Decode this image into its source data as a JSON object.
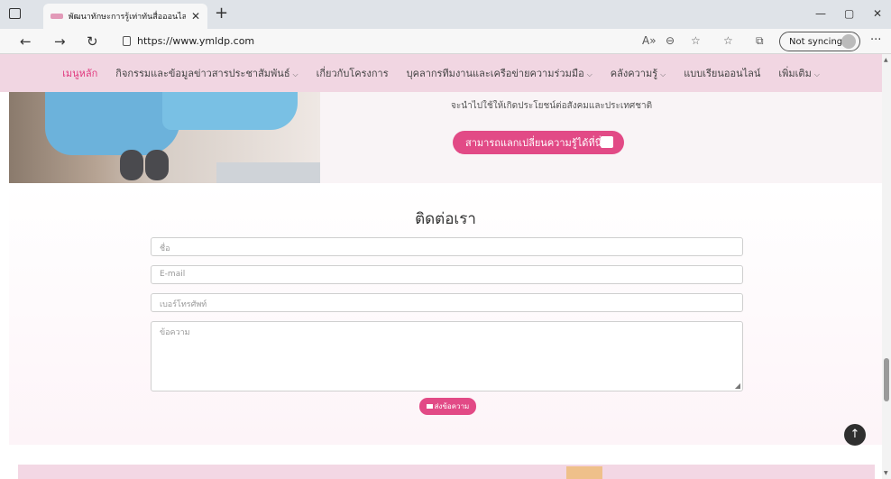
{
  "browser": {
    "tab_title": "พัฒนาทักษะการรู้เท่าทันสื่อออนไลน์ ไม่",
    "tab_close": "✕",
    "new_tab": "+",
    "url": "https://www.ymldp.com",
    "sync_label": "Not syncing",
    "window_controls": [
      "—",
      "▢",
      "✕"
    ],
    "icons": [
      "back-icon",
      "forward-icon",
      "refresh-icon",
      "lock-icon",
      "read-aloud-icon",
      "zoom-icon",
      "favorites-add-icon",
      "favorites-icon",
      "collections-icon",
      "profile-icon",
      "more-icon"
    ]
  },
  "nav": {
    "items": [
      {
        "label": "เมนูหลัก",
        "active": true,
        "dropdown": false
      },
      {
        "label": "กิจกรรมและข้อมูลข่าวสารประชาสัมพันธ์",
        "active": false,
        "dropdown": true
      },
      {
        "label": "เกี่ยวกับโครงการ",
        "active": false,
        "dropdown": false
      },
      {
        "label": "บุคลากรทีมงานและเครือข่ายความร่วมมือ",
        "active": false,
        "dropdown": true
      },
      {
        "label": "คลังความรู้",
        "active": false,
        "dropdown": true
      },
      {
        "label": "แบบเรียนออนไลน์",
        "active": false,
        "dropdown": false
      },
      {
        "label": "เพิ่มเติม",
        "active": false,
        "dropdown": true
      }
    ],
    "active_color": "#e0397e",
    "background": "#f1d6e2"
  },
  "hero": {
    "text": "จะนำไปใช้ให้เกิดประโยชน์ต่อสังคมและประเทศชาติ",
    "cta_label": "สามารถแลกเปลี่ยนความรู้ได้ที่นี่",
    "cta_color": "#e24a86"
  },
  "contact": {
    "title": "ติดต่อเรา",
    "name_placeholder": "ชื่อ",
    "email_placeholder": "E-mail",
    "phone_placeholder": "เบอร์โทรศัพท์",
    "message_placeholder": "ข้อความ",
    "send_label": "ส่งข้อความ"
  }
}
